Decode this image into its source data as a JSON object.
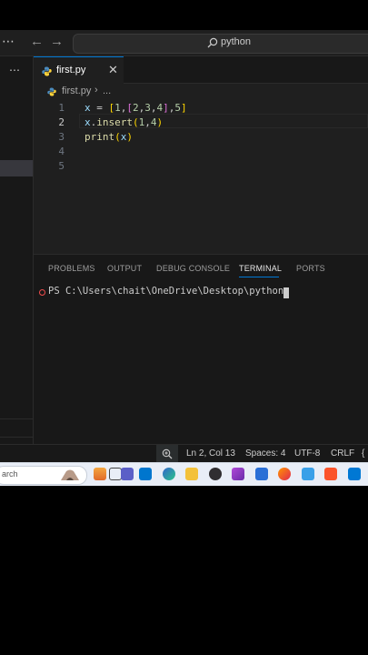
{
  "titlebar": {
    "more": "⋯",
    "back": "←",
    "forward": "→",
    "search_text": "python"
  },
  "sidebar": {
    "more": "⋯"
  },
  "tab": {
    "filename": "first.py",
    "close": "✕"
  },
  "breadcrumb": {
    "file": "first.py",
    "chevron": "›",
    "ellipsis": "..."
  },
  "editor": {
    "lines": [
      {
        "n": "1",
        "text": "x = [1,[2,3,4],5]"
      },
      {
        "n": "2",
        "text": "x.insert(1,4)"
      },
      {
        "n": "3",
        "text": "print(x)"
      },
      {
        "n": "4",
        "text": ""
      },
      {
        "n": "5",
        "text": ""
      }
    ]
  },
  "panel": {
    "tabs": [
      "PROBLEMS",
      "OUTPUT",
      "DEBUG CONSOLE",
      "TERMINAL",
      "PORTS"
    ],
    "active_tab": "TERMINAL",
    "terminal_prompt": "PS C:\\Users\\chait\\OneDrive\\Desktop\\python>"
  },
  "status": {
    "zoom_icon": "zoom-in-icon",
    "position": "Ln 2, Col 13",
    "spaces": "Spaces: 4",
    "encoding": "UTF-8",
    "eol": "CRLF",
    "lang_brace": "{"
  },
  "taskbar": {
    "search_text": "arch",
    "icons": [
      "widgets-icon",
      "task-view-icon",
      "teams-icon",
      "dell-icon",
      "edge-icon",
      "file-explorer-icon",
      "obs-icon",
      "media-icon",
      "store-icon",
      "firefox-icon",
      "notepad-icon",
      "brave-icon",
      "vscode-icon"
    ]
  },
  "colors": {
    "accent": "#0078d4",
    "editor_bg": "#1f1f1f",
    "panel_bg": "#181818"
  }
}
